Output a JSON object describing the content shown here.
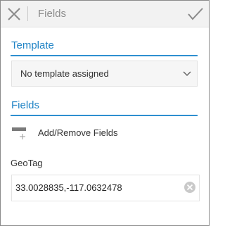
{
  "window": {
    "title": "Fields",
    "close_icon": "close-icon",
    "done_icon": "checkmark-icon"
  },
  "template": {
    "header": "Template",
    "selected_value": "No template assigned",
    "dropdown_icon": "chevron-down-icon"
  },
  "fields": {
    "header": "Fields",
    "add_remove_label": "Add/Remove Fields",
    "add_remove_icon": "add-field-icon"
  },
  "geotag": {
    "label": "GeoTag",
    "value": "33.0028835,-117.0632478",
    "clear_icon": "clear-icon"
  },
  "colors": {
    "accent": "#2e8fd0",
    "accent_text": "#1f83c5",
    "toolbar_bg": "#f2f2f2",
    "title_text": "#8c8c8c"
  }
}
